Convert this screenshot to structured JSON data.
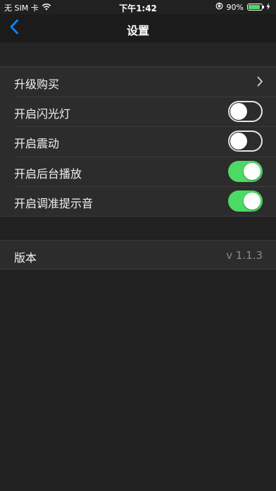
{
  "status_bar": {
    "carrier": "无 SIM 卡",
    "time": "下午1:42",
    "battery_percent": "90%",
    "battery_level": 0.9,
    "icons": [
      "wifi-icon",
      "orientation-lock-icon",
      "battery-icon",
      "charging-bolt-icon"
    ]
  },
  "nav": {
    "title": "设置",
    "back_icon": "chevron-left-icon"
  },
  "settings": {
    "rows": [
      {
        "label": "升级购买",
        "type": "link"
      },
      {
        "label": "开启闪光灯",
        "type": "toggle",
        "on": false
      },
      {
        "label": "开启震动",
        "type": "toggle",
        "on": false
      },
      {
        "label": "开启后台播放",
        "type": "toggle",
        "on": true
      },
      {
        "label": "开启调准提示音",
        "type": "toggle",
        "on": true
      }
    ]
  },
  "about": {
    "version_label": "版本",
    "version_value": "v 1.1.3"
  },
  "colors": {
    "accent_blue": "#0a84ff",
    "toggle_on": "#4cd964",
    "background": "#212121",
    "cell": "#2c2c2c"
  }
}
